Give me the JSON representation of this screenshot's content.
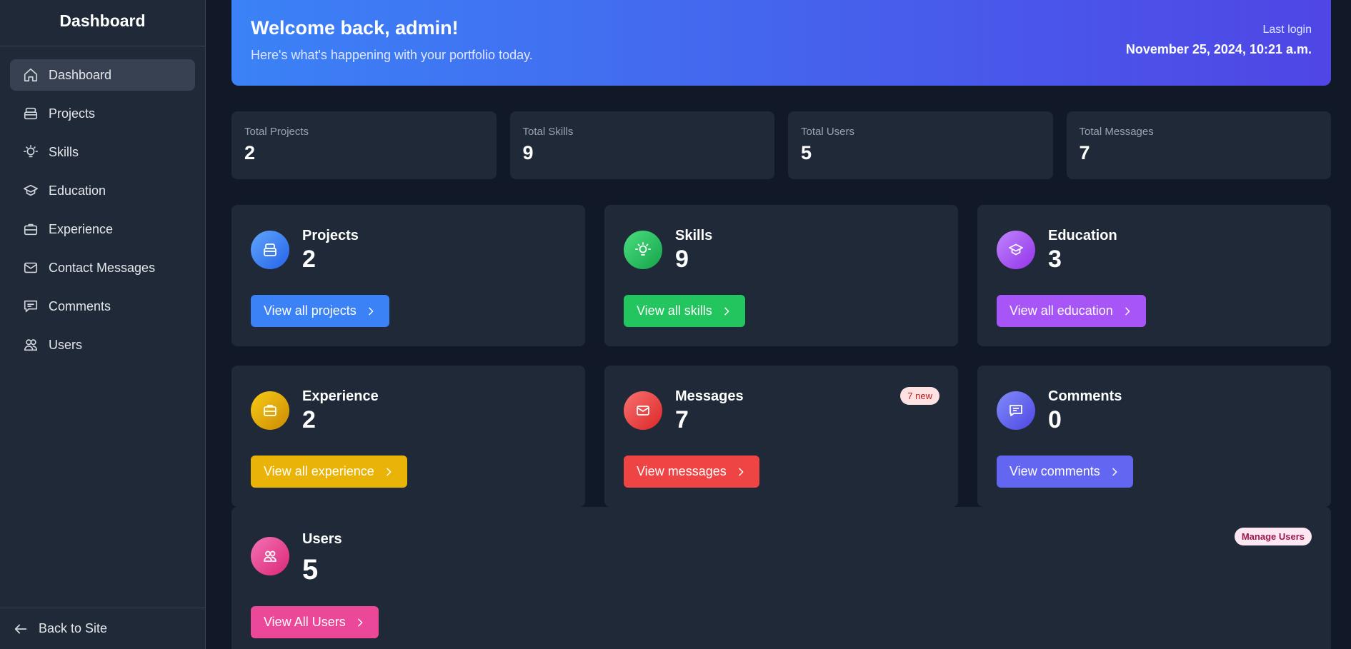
{
  "sidebar": {
    "title": "Dashboard",
    "items": [
      {
        "label": "Dashboard",
        "icon": "home-icon",
        "active": true
      },
      {
        "label": "Projects",
        "icon": "archive-icon"
      },
      {
        "label": "Skills",
        "icon": "lightbulb-icon"
      },
      {
        "label": "Education",
        "icon": "graduation-cap-icon"
      },
      {
        "label": "Experience",
        "icon": "briefcase-icon"
      },
      {
        "label": "Contact Messages",
        "icon": "mail-icon"
      },
      {
        "label": "Comments",
        "icon": "comment-icon"
      },
      {
        "label": "Users",
        "icon": "users-icon"
      }
    ],
    "footer": "Back to Site"
  },
  "welcome": {
    "title": "Welcome back, admin!",
    "subtitle": "Here's what's happening with your portfolio today.",
    "last_login_label": "Last login",
    "last_login_value": "November 25, 2024, 10:21 a.m."
  },
  "stats": [
    {
      "label": "Total Projects",
      "value": "2"
    },
    {
      "label": "Total Skills",
      "value": "9"
    },
    {
      "label": "Total Users",
      "value": "5"
    },
    {
      "label": "Total Messages",
      "value": "7"
    }
  ],
  "cards": {
    "projects": {
      "title": "Projects",
      "count": "2",
      "button": "View all projects",
      "color": "#3b82f6"
    },
    "skills": {
      "title": "Skills",
      "count": "9",
      "button": "View all skills",
      "color": "#22c55e"
    },
    "education": {
      "title": "Education",
      "count": "3",
      "button": "View all education",
      "color": "#a855f7"
    },
    "experience": {
      "title": "Experience",
      "count": "2",
      "button": "View all experience",
      "color": "#eab308"
    },
    "messages": {
      "title": "Messages",
      "count": "7",
      "button": "View messages",
      "badge": "7 new",
      "color": "#ef4444"
    },
    "comments": {
      "title": "Comments",
      "count": "0",
      "button": "View comments",
      "color": "#6366f1"
    },
    "users": {
      "title": "Users",
      "count": "5",
      "button": "View All Users",
      "badge": "Manage Users",
      "color": "#ec4899"
    }
  }
}
